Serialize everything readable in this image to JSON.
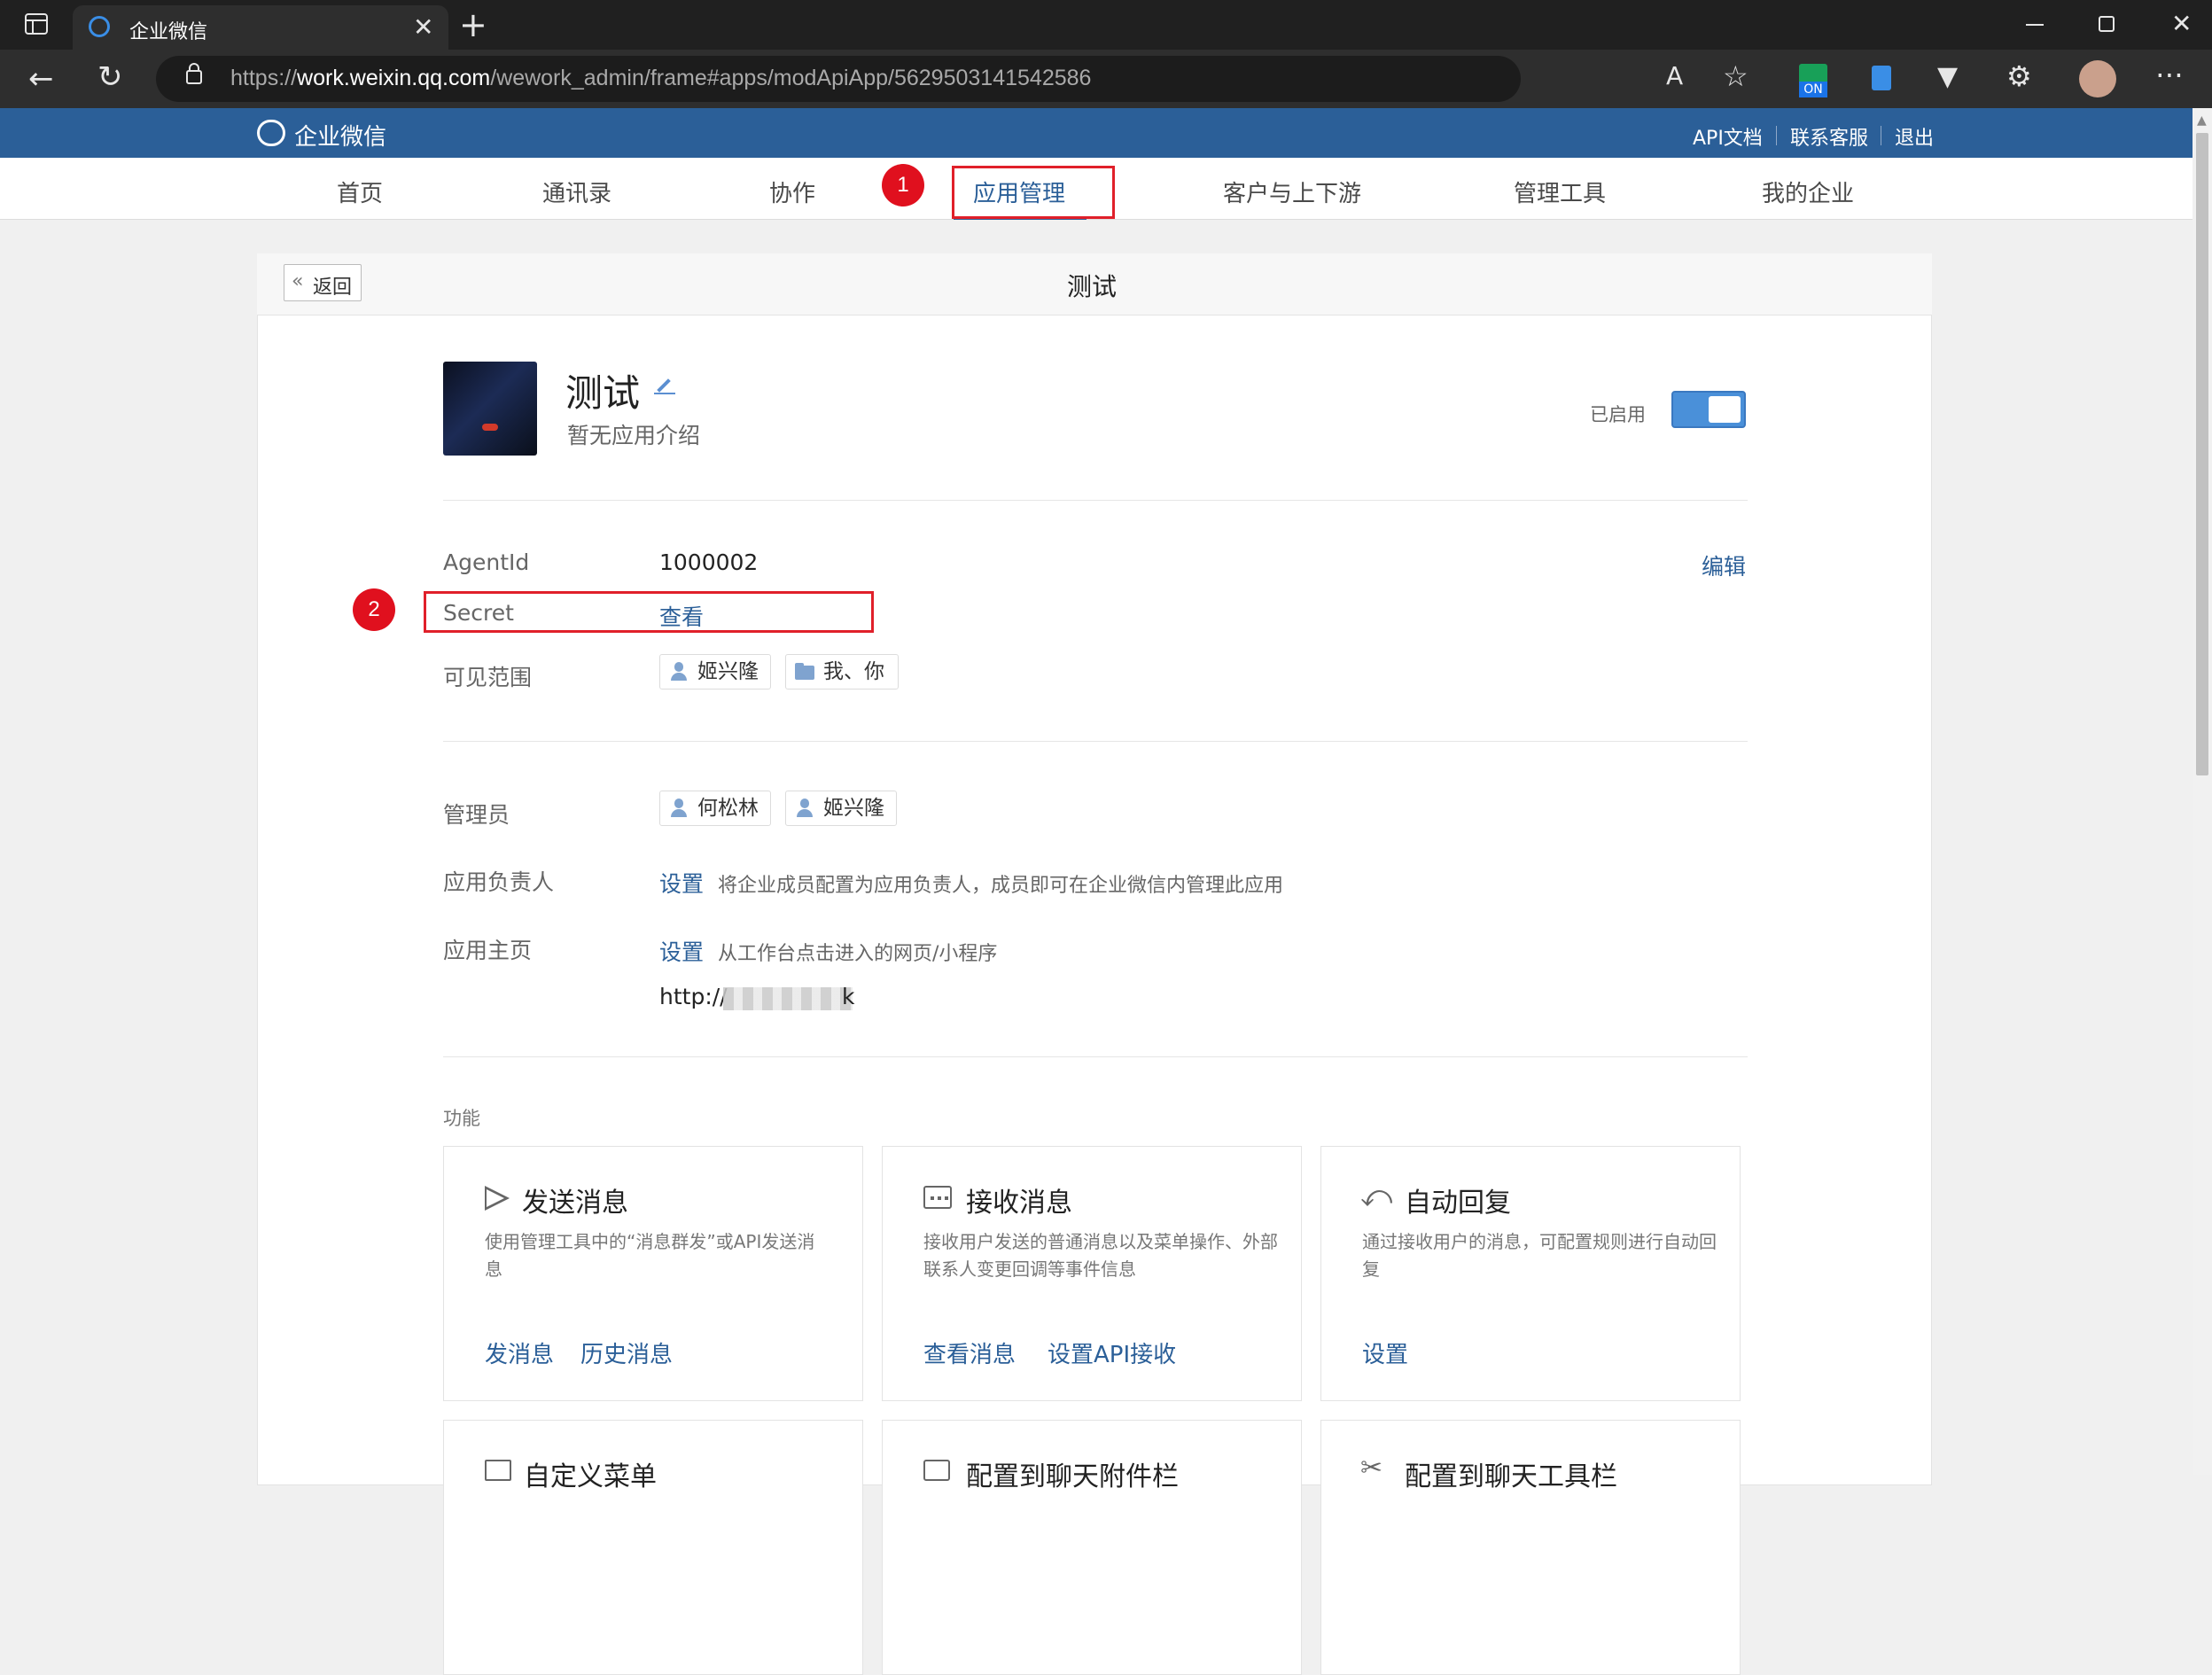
{
  "browser": {
    "tab_title": "企业微信",
    "url_prefix": "https://",
    "url_host": "work.weixin.qq.com",
    "url_path": "/wework_admin/frame#apps/modApiApp/5629503141542586",
    "ext_badge": "ON"
  },
  "header": {
    "logo_text": "企业微信",
    "links": [
      "API文档",
      "联系客服",
      "退出"
    ]
  },
  "nav": {
    "items": [
      "首页",
      "通讯录",
      "协作",
      "应用管理",
      "客户与上下游",
      "管理工具",
      "我的企业"
    ],
    "active": "应用管理"
  },
  "annotations": {
    "badge1": "1",
    "badge2": "2"
  },
  "page": {
    "back_label": "返回",
    "title": "测试"
  },
  "app": {
    "name": "测试",
    "intro": "暂无应用介绍",
    "status_label": "已启用",
    "agentid_label": "AgentId",
    "agentid_value": "1000002",
    "edit_label": "编辑",
    "secret_label": "Secret",
    "secret_action": "查看",
    "visible_label": "可见范围",
    "visible_chips": [
      "姬兴隆",
      "我、你"
    ],
    "admin_label": "管理员",
    "admin_chips": [
      "何松林",
      "姬兴隆"
    ],
    "owner_label": "应用负责人",
    "owner_action": "设置",
    "owner_hint": "将企业成员配置为应用负责人，成员即可在企业微信内管理此应用",
    "home_label": "应用主页",
    "home_action": "设置",
    "home_hint": "从工作台点击进入的网页/小程序",
    "home_url": "http://"
  },
  "features": {
    "section_label": "功能",
    "cards": [
      {
        "title": "发送消息",
        "desc": "使用管理工具中的“消息群发”或API发送消息",
        "links": [
          "发消息",
          "历史消息"
        ]
      },
      {
        "title": "接收消息",
        "desc": "接收用户发送的普通消息以及菜单操作、外部联系人变更回调等事件信息",
        "links": [
          "查看消息",
          "设置API接收"
        ]
      },
      {
        "title": "自动回复",
        "desc": "通过接收用户的消息，可配置规则进行自动回复",
        "links": [
          "设置"
        ]
      }
    ],
    "partial_titles": [
      "自定义菜单",
      "配置到聊天附件栏",
      "配置到聊天工具栏"
    ]
  },
  "colors": {
    "brand": "#2b5f98",
    "annotation_red": "#e0202a",
    "toggle_on": "#4a90d9"
  }
}
